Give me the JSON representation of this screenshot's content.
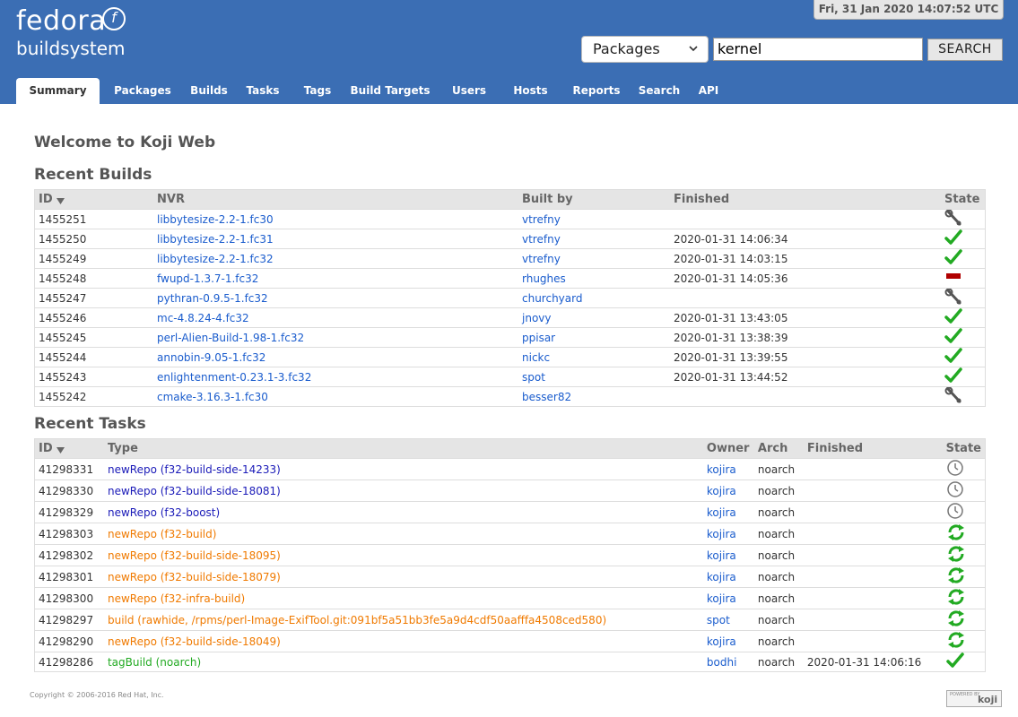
{
  "header": {
    "logo_line1": "fedora",
    "logo_line2": "buildsystem",
    "clock": "Fri, 31 Jan 2020 14:07:52 UTC",
    "search_type": "Packages",
    "search_value": "kernel",
    "search_button": "SEARCH"
  },
  "tabs": [
    "Summary",
    "Packages",
    "Builds",
    "Tasks",
    "Tags",
    "Build Targets",
    "Users",
    "Hosts",
    "Reports",
    "Search",
    "API"
  ],
  "active_tab": "Summary",
  "page_title": "Welcome to Koji Web",
  "builds": {
    "title": "Recent Builds",
    "headers": [
      "ID",
      "NVR",
      "Built by",
      "Finished",
      "State"
    ],
    "rows": [
      {
        "id": "1455251",
        "nvr": "libbytesize-2.2-1.fc30",
        "by": "vtrefny",
        "finished": "",
        "state": "building"
      },
      {
        "id": "1455250",
        "nvr": "libbytesize-2.2-1.fc31",
        "by": "vtrefny",
        "finished": "2020-01-31 14:06:34",
        "state": "complete"
      },
      {
        "id": "1455249",
        "nvr": "libbytesize-2.2-1.fc32",
        "by": "vtrefny",
        "finished": "2020-01-31 14:03:15",
        "state": "complete"
      },
      {
        "id": "1455248",
        "nvr": "fwupd-1.3.7-1.fc32",
        "by": "rhughes",
        "finished": "2020-01-31 14:05:36",
        "state": "canceled"
      },
      {
        "id": "1455247",
        "nvr": "pythran-0.9.5-1.fc32",
        "by": "churchyard",
        "finished": "",
        "state": "building"
      },
      {
        "id": "1455246",
        "nvr": "mc-4.8.24-4.fc32",
        "by": "jnovy",
        "finished": "2020-01-31 13:43:05",
        "state": "complete"
      },
      {
        "id": "1455245",
        "nvr": "perl-Alien-Build-1.98-1.fc32",
        "by": "ppisar",
        "finished": "2020-01-31 13:38:39",
        "state": "complete"
      },
      {
        "id": "1455244",
        "nvr": "annobin-9.05-1.fc32",
        "by": "nickc",
        "finished": "2020-01-31 13:39:55",
        "state": "complete"
      },
      {
        "id": "1455243",
        "nvr": "enlightenment-0.23.1-3.fc32",
        "by": "spot",
        "finished": "2020-01-31 13:44:52",
        "state": "complete"
      },
      {
        "id": "1455242",
        "nvr": "cmake-3.16.3-1.fc30",
        "by": "besser82",
        "finished": "",
        "state": "building"
      }
    ]
  },
  "tasks": {
    "title": "Recent Tasks",
    "headers": [
      "ID",
      "Type",
      "Owner",
      "Arch",
      "Finished",
      "State"
    ],
    "rows": [
      {
        "id": "41298331",
        "type": "newRepo (f32-build-side-14233)",
        "owner": "kojira",
        "arch": "noarch",
        "finished": "",
        "state": "free",
        "color": "blue"
      },
      {
        "id": "41298330",
        "type": "newRepo (f32-build-side-18081)",
        "owner": "kojira",
        "arch": "noarch",
        "finished": "",
        "state": "free",
        "color": "blue"
      },
      {
        "id": "41298329",
        "type": "newRepo (f32-boost)",
        "owner": "kojira",
        "arch": "noarch",
        "finished": "",
        "state": "free",
        "color": "blue"
      },
      {
        "id": "41298303",
        "type": "newRepo (f32-build)",
        "owner": "kojira",
        "arch": "noarch",
        "finished": "",
        "state": "open",
        "color": "orange"
      },
      {
        "id": "41298302",
        "type": "newRepo (f32-build-side-18095)",
        "owner": "kojira",
        "arch": "noarch",
        "finished": "",
        "state": "open",
        "color": "orange"
      },
      {
        "id": "41298301",
        "type": "newRepo (f32-build-side-18079)",
        "owner": "kojira",
        "arch": "noarch",
        "finished": "",
        "state": "open",
        "color": "orange"
      },
      {
        "id": "41298300",
        "type": "newRepo (f32-infra-build)",
        "owner": "kojira",
        "arch": "noarch",
        "finished": "",
        "state": "open",
        "color": "orange"
      },
      {
        "id": "41298297",
        "type": "build (rawhide, /rpms/perl-Image-ExifTool.git:091bf5a51bb3fe5a9d4cdf50aafffa4508ced580)",
        "owner": "spot",
        "arch": "noarch",
        "finished": "",
        "state": "open",
        "color": "orange"
      },
      {
        "id": "41298290",
        "type": "newRepo (f32-build-side-18049)",
        "owner": "kojira",
        "arch": "noarch",
        "finished": "",
        "state": "open",
        "color": "orange"
      },
      {
        "id": "41298286",
        "type": "tagBuild (noarch)",
        "owner": "bodhi",
        "arch": "noarch",
        "finished": "2020-01-31 14:06:16",
        "state": "closed",
        "color": "green"
      }
    ]
  },
  "footer": {
    "copyright": "Copyright © 2006-2016 Red Hat, Inc.",
    "powered_top": "POWERED BY",
    "powered_brand": "koji"
  },
  "colors": {
    "header_bg": "#3b6eb4",
    "link": "#1a5ccd",
    "complete": "#22aa22",
    "canceled": "#b00000"
  }
}
